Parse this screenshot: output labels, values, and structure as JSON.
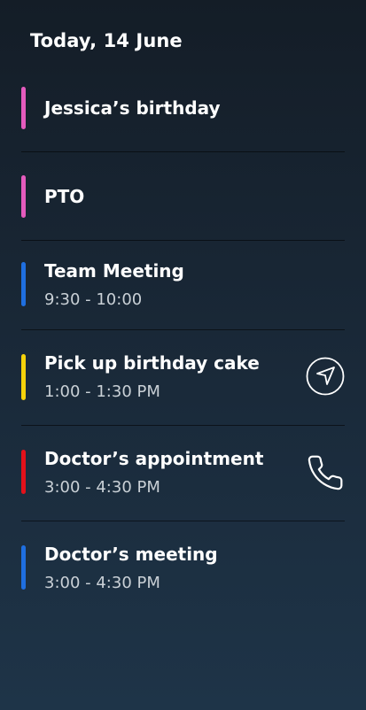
{
  "header": {
    "title": "Today, 14 June"
  },
  "events": [
    {
      "title": "Jessica’s birthday",
      "time": "",
      "color": "#e45bbd",
      "action": ""
    },
    {
      "title": "PTO",
      "time": "",
      "color": "#e45bbd",
      "action": ""
    },
    {
      "title": "Team Meeting",
      "time": "9:30 - 10:00",
      "color": "#1f6fe0",
      "action": ""
    },
    {
      "title": "Pick up birthday cake",
      "time": "1:00 - 1:30 PM",
      "color": "#f5d20a",
      "action": "navigate-icon"
    },
    {
      "title": "Doctor’s appointment",
      "time": "3:00 - 4:30 PM",
      "color": "#e3111a",
      "action": "phone-icon"
    },
    {
      "title": "Doctor’s meeting",
      "time": "3:00 - 4:30 PM",
      "color": "#1f6fe0",
      "action": ""
    }
  ]
}
